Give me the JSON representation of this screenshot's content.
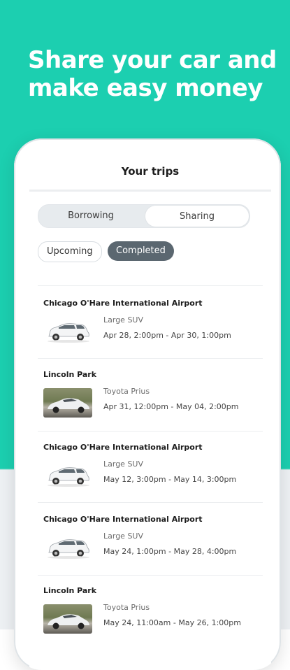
{
  "headline": "Share your car and make easy money",
  "screen": {
    "title": "Your trips",
    "segments": [
      "Borrowing",
      "Sharing"
    ],
    "active_segment": "Sharing",
    "filters": [
      "Upcoming",
      "Completed"
    ],
    "active_filter": "Completed"
  },
  "trips": [
    {
      "location": "Chicago O'Hare International Airport",
      "vehicle": "Large SUV",
      "dates": "Apr 28, 2:00pm - Apr 30, 1:00pm",
      "thumb": "suv"
    },
    {
      "location": "Lincoln Park",
      "vehicle": "Toyota Prius",
      "dates": "Apr 31, 12:00pm - May 04, 2:00pm",
      "thumb": "prius"
    },
    {
      "location": "Chicago O'Hare International Airport",
      "vehicle": "Large SUV",
      "dates": "May 12, 3:00pm - May 14, 3:00pm",
      "thumb": "suv"
    },
    {
      "location": "Chicago O'Hare International Airport",
      "vehicle": "Large SUV",
      "dates": "May 24, 1:00pm - May 28, 4:00pm",
      "thumb": "suv"
    },
    {
      "location": "Lincoln Park",
      "vehicle": "Toyota Prius",
      "dates": "May 24, 11:00am - May 26, 1:00pm",
      "thumb": "prius"
    }
  ],
  "colors": {
    "brand_teal": "#1ccfb0",
    "active_chip": "#5b6770"
  }
}
